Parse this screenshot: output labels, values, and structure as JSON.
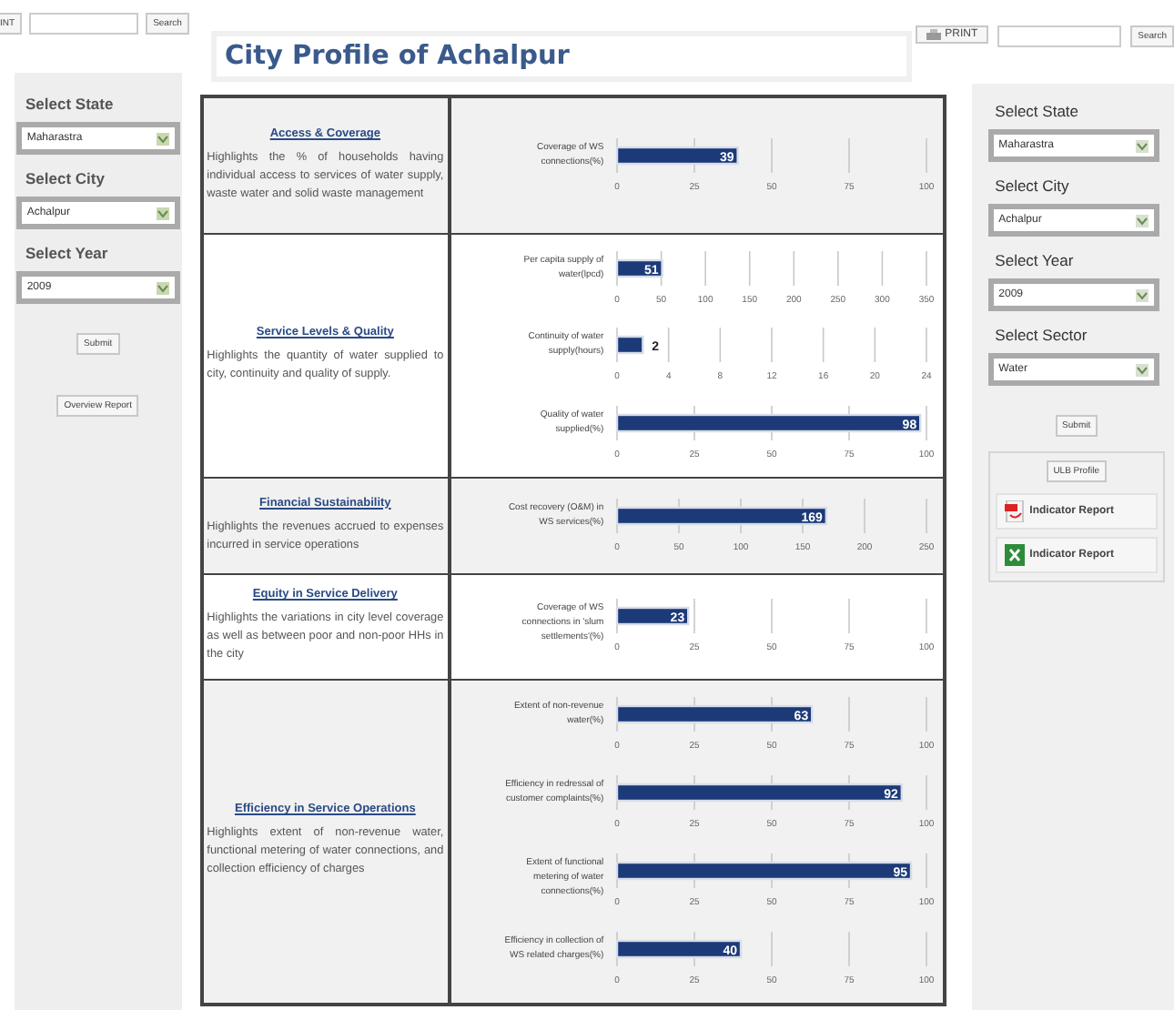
{
  "top_left": {
    "print_button": "INT",
    "search_button": "Search"
  },
  "left_panel": {
    "fields": [
      {
        "label": "Select State",
        "value": "Maharastra"
      },
      {
        "label": "Select City",
        "value": "Achalpur"
      },
      {
        "label": "Select Year",
        "value": "2009"
      }
    ],
    "submit": "Submit",
    "report_button": "Overview Report"
  },
  "header": {
    "title": "City Profile of Achalpur",
    "print_button": "PRINT",
    "search_button": "Search"
  },
  "sections": [
    {
      "title": "Access & Coverage",
      "description": "Highlights the % of households having individual access to services of water supply, waste water and solid waste management",
      "shaded": true,
      "charts": [
        {
          "chart_data": {
            "type": "bar",
            "orientation": "horizontal",
            "categories": [
              "Coverage of WS connections(%)"
            ],
            "values": [
              39
            ],
            "xlim": [
              0,
              100
            ],
            "xticks": [
              0,
              25,
              50,
              75,
              100
            ],
            "data_labels": true,
            "grid": true
          }
        }
      ]
    },
    {
      "title": "Service Levels & Quality",
      "description": "Highlights the quantity of water supplied to city, continuity and quality of supply.",
      "shaded": false,
      "charts": [
        {
          "chart_data": {
            "type": "bar",
            "orientation": "horizontal",
            "categories": [
              "Per capita supply of water(lpcd)"
            ],
            "values": [
              51
            ],
            "xlim": [
              0,
              350
            ],
            "xticks": [
              0,
              50,
              100,
              150,
              200,
              250,
              300,
              350
            ],
            "data_labels": true,
            "grid": true
          }
        },
        {
          "chart_data": {
            "type": "bar",
            "orientation": "horizontal",
            "categories": [
              "Continuity of water supply(hours)"
            ],
            "values": [
              2
            ],
            "xlim": [
              0,
              24
            ],
            "xticks": [
              0,
              4,
              8,
              12,
              16,
              20,
              24
            ],
            "data_labels": true,
            "grid": true
          }
        },
        {
          "chart_data": {
            "type": "bar",
            "orientation": "horizontal",
            "categories": [
              "Quality of water supplied(%)"
            ],
            "values": [
              98
            ],
            "xlim": [
              0,
              100
            ],
            "xticks": [
              0,
              25,
              50,
              75,
              100
            ],
            "data_labels": true,
            "grid": true
          }
        }
      ]
    },
    {
      "title": "Financial Sustainability",
      "description": "Highlights the revenues accrued to expenses incurred in service operations",
      "shaded": true,
      "charts": [
        {
          "chart_data": {
            "type": "bar",
            "orientation": "horizontal",
            "categories": [
              "Cost recovery (O&M) in WS services(%)"
            ],
            "values": [
              169
            ],
            "xlim": [
              0,
              250
            ],
            "xticks": [
              0,
              50,
              100,
              150,
              200,
              250
            ],
            "data_labels": true,
            "grid": true
          }
        }
      ]
    },
    {
      "title": "Equity in Service Delivery",
      "description": "Highlights the variations in city level coverage as well as between poor and non-poor HHs in the city",
      "shaded": false,
      "charts": [
        {
          "chart_data": {
            "type": "bar",
            "orientation": "horizontal",
            "categories": [
              "Coverage of WS connections in 'slum settlements'(%)"
            ],
            "values": [
              23
            ],
            "xlim": [
              0,
              100
            ],
            "xticks": [
              0,
              25,
              50,
              75,
              100
            ],
            "data_labels": true,
            "grid": true
          }
        }
      ]
    },
    {
      "title": "Efficiency in Service Operations",
      "description": "Highlights extent of non-revenue water, functional metering of water connections, and collection efficiency of charges",
      "shaded": true,
      "charts": [
        {
          "chart_data": {
            "type": "bar",
            "orientation": "horizontal",
            "categories": [
              "Extent of non-revenue water(%)"
            ],
            "values": [
              63
            ],
            "xlim": [
              0,
              100
            ],
            "xticks": [
              0,
              25,
              50,
              75,
              100
            ],
            "data_labels": true,
            "grid": true
          }
        },
        {
          "chart_data": {
            "type": "bar",
            "orientation": "horizontal",
            "categories": [
              "Efficiency in redressal of customer complaints(%)"
            ],
            "values": [
              92
            ],
            "xlim": [
              0,
              100
            ],
            "xticks": [
              0,
              25,
              50,
              75,
              100
            ],
            "data_labels": true,
            "grid": true
          }
        },
        {
          "chart_data": {
            "type": "bar",
            "orientation": "horizontal",
            "categories": [
              "Extent of functional metering of water connections(%)"
            ],
            "values": [
              95
            ],
            "xlim": [
              0,
              100
            ],
            "xticks": [
              0,
              25,
              50,
              75,
              100
            ],
            "data_labels": true,
            "grid": true
          }
        },
        {
          "chart_data": {
            "type": "bar",
            "orientation": "horizontal",
            "categories": [
              "Efficiency in collection of WS related charges(%)"
            ],
            "values": [
              40
            ],
            "xlim": [
              0,
              100
            ],
            "xticks": [
              0,
              25,
              50,
              75,
              100
            ],
            "data_labels": true,
            "grid": true
          }
        }
      ]
    }
  ],
  "right_panel": {
    "fields": [
      {
        "label": "Select State",
        "value": "Maharastra"
      },
      {
        "label": "Select City",
        "value": "Achalpur"
      },
      {
        "label": "Select Year",
        "value": "2009"
      },
      {
        "label": "Select Sector",
        "value": "Water"
      }
    ],
    "submit": "Submit",
    "profile_button": "ULB Profile",
    "reports": [
      {
        "kind": "pdf",
        "label": "Indicator Report"
      },
      {
        "kind": "excel",
        "label": "Indicator Report"
      }
    ]
  }
}
